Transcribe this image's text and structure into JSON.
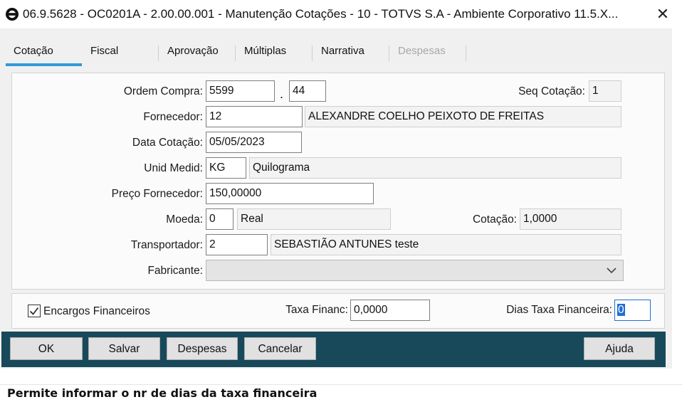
{
  "window": {
    "title": "06.9.5628 - OC0201A - 2.00.00.001 - Manutenção Cotações - 10 - TOTVS S.A - Ambiente Corporativo 11.5.X...",
    "close_glyph": "✕"
  },
  "tabs": [
    {
      "label": "Cotação",
      "active": true,
      "enabled": true
    },
    {
      "label": "Fiscal",
      "active": false,
      "enabled": true
    },
    {
      "label": "Aprovação",
      "active": false,
      "enabled": true
    },
    {
      "label": "Múltiplas",
      "active": false,
      "enabled": true
    },
    {
      "label": "Narrativa",
      "active": false,
      "enabled": true
    },
    {
      "label": "Despesas",
      "active": false,
      "enabled": false
    }
  ],
  "form": {
    "ordem_compra": {
      "label": "Ordem Compra:",
      "value": "5599",
      "separator": ".",
      "seq_value": "44"
    },
    "seq_cotacao": {
      "label": "Seq Cotação:",
      "value": "1"
    },
    "fornecedor": {
      "label": "Fornecedor:",
      "code": "12",
      "name": "ALEXANDRE COELHO PEIXOTO DE FREITAS"
    },
    "data_cotacao": {
      "label": "Data Cotação:",
      "value": "05/05/2023"
    },
    "unid_medid": {
      "label": "Unid Medid:",
      "code": "KG",
      "description": "Quilograma"
    },
    "preco_fornecedor": {
      "label": "Preço Fornecedor:",
      "value": "150,00000"
    },
    "moeda": {
      "label": "Moeda:",
      "code": "0",
      "description": "Real"
    },
    "cotacao": {
      "label": "Cotação:",
      "value": "1,0000"
    },
    "transportador": {
      "label": "Transportador:",
      "code": "2",
      "name": "SEBASTIÃO ANTUNES teste"
    },
    "fabricante": {
      "label": "Fabricante:",
      "value": ""
    }
  },
  "financeiro": {
    "encargos_label": "Encargos Financeiros",
    "encargos_checked": true,
    "taxa_financ_label": "Taxa Financ:",
    "taxa_financ_value": "0,0000",
    "dias_taxa_label": "Dias Taxa Financeira:",
    "dias_taxa_value": "0"
  },
  "buttons": {
    "ok": "OK",
    "salvar": "Salvar",
    "despesas": "Despesas",
    "cancelar": "Cancelar",
    "ajuda": "Ajuda"
  },
  "status": {
    "text": "Permite informar o nr de dias da taxa financeira"
  },
  "colors": {
    "tab_accent": "#2f9bd6",
    "button_bar": "#17495a",
    "focus_border": "#1f6fd1"
  },
  "icons": {
    "app": "totvs-logo-icon",
    "close": "close-icon",
    "combo": "chevron-down-icon",
    "check": "checkmark-icon"
  }
}
